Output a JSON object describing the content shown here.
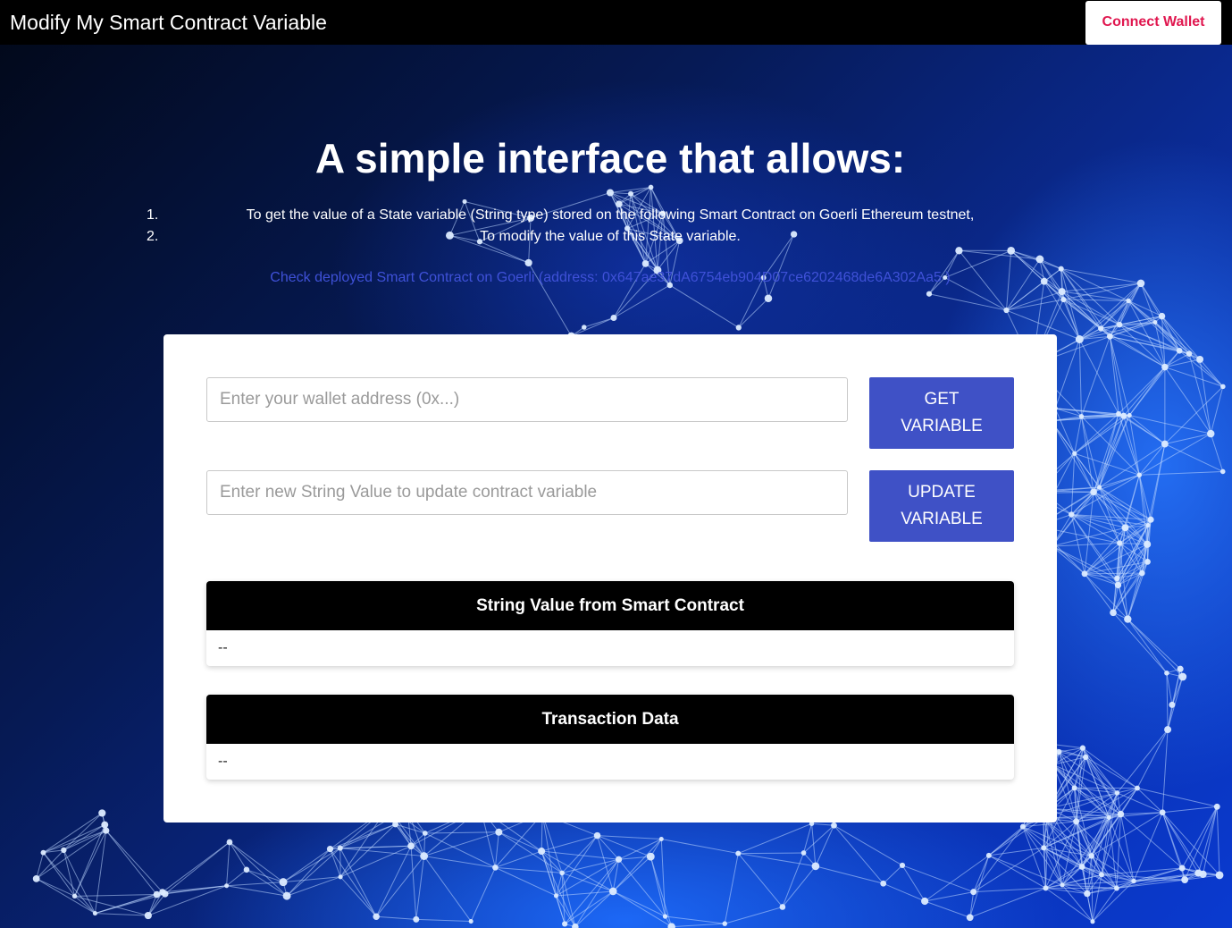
{
  "navbar": {
    "title": "Modify My Smart Contract Variable",
    "connect_label": "Connect Wallet"
  },
  "hero": {
    "title": "A simple interface that allows:",
    "steps": [
      {
        "num": "1.",
        "text": "To get the value of a State variable (String type) stored on the following Smart Contract on Goerli Ethereum testnet,"
      },
      {
        "num": "2.",
        "text": "To modify the value of this State variable."
      }
    ],
    "link_text": "Check deployed Smart Contract on Goerli (address: 0x647ae37dA6754eb904D07ce6202468de6A302Aa5 )"
  },
  "form": {
    "wallet_placeholder": "Enter your wallet address (0x...)",
    "wallet_value": "",
    "value_placeholder": "Enter new String Value to update contract variable",
    "value_value": "",
    "get_label": "GET VARIABLE",
    "update_label": "UPDATE VARIABLE"
  },
  "results": {
    "string_title": "String Value from Smart Contract",
    "string_value": "--",
    "tx_title": "Transaction Data",
    "tx_value": "--"
  },
  "colors": {
    "navbar_bg": "#000000",
    "connect_text": "#e0174f",
    "button_bg": "#3f51c6",
    "link": "#3f51d8"
  }
}
